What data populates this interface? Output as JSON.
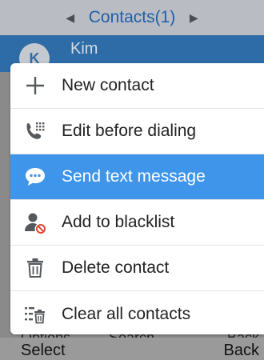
{
  "header": {
    "title": "Contacts(1)",
    "prev_icon": "triangle-left-icon",
    "next_icon": "triangle-right-icon"
  },
  "contact": {
    "initial": "K",
    "name": "Kim"
  },
  "menu": {
    "items": [
      {
        "label": "New contact",
        "icon": "plus-icon",
        "active": false
      },
      {
        "label": "Edit before dialing",
        "icon": "phone-keypad-icon",
        "active": false
      },
      {
        "label": "Send text message",
        "icon": "message-bubble-icon",
        "active": true
      },
      {
        "label": "Add to blacklist",
        "icon": "person-blocked-icon",
        "active": false
      },
      {
        "label": "Delete contact",
        "icon": "trash-icon",
        "active": false
      },
      {
        "label": "Clear all contacts",
        "icon": "list-trash-icon",
        "active": false
      }
    ]
  },
  "underlay_softkeys": {
    "left": "Options",
    "middle": "Search",
    "right": "Back"
  },
  "softkeys": {
    "left": "Select",
    "right": "Back"
  },
  "colors": {
    "titlebar": "#b9bdc3",
    "contact_row": "#2d6ca7",
    "highlight": "#3f95e9",
    "icon_gray": "#55595e",
    "blocked_red": "#e0452f"
  }
}
